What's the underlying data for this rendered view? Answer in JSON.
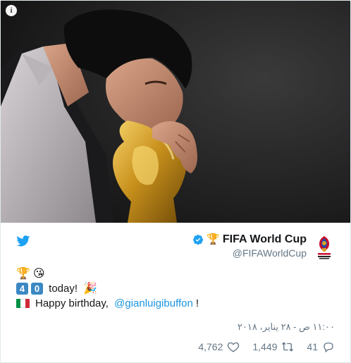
{
  "photo": {
    "info_glyph": "i"
  },
  "account": {
    "trophy_icon": "🏆",
    "name": "FIFA World Cup",
    "handle": "@FIFAWorldCup",
    "verified": true
  },
  "tweet": {
    "line1_emojis": [
      "🏆",
      "😘"
    ],
    "keycap_digits": [
      "4",
      "0"
    ],
    "line2_text": " today! ",
    "party_emoji": "🎉",
    "line3_prefix": "Happy birthday, ",
    "mention": "@gianluigibuffon",
    "line3_suffix": "!"
  },
  "timestamp": "١١:٠٠ ص - ٢٨ يناير، ٢٠١٨",
  "stats": {
    "likes": "4,762",
    "retweets": "1,449",
    "replies": "41"
  },
  "colors": {
    "link": "#1b95e0",
    "secondary_text": "#657786",
    "twitter_blue": "#1da1f2",
    "keycap": "#3b88c3"
  }
}
